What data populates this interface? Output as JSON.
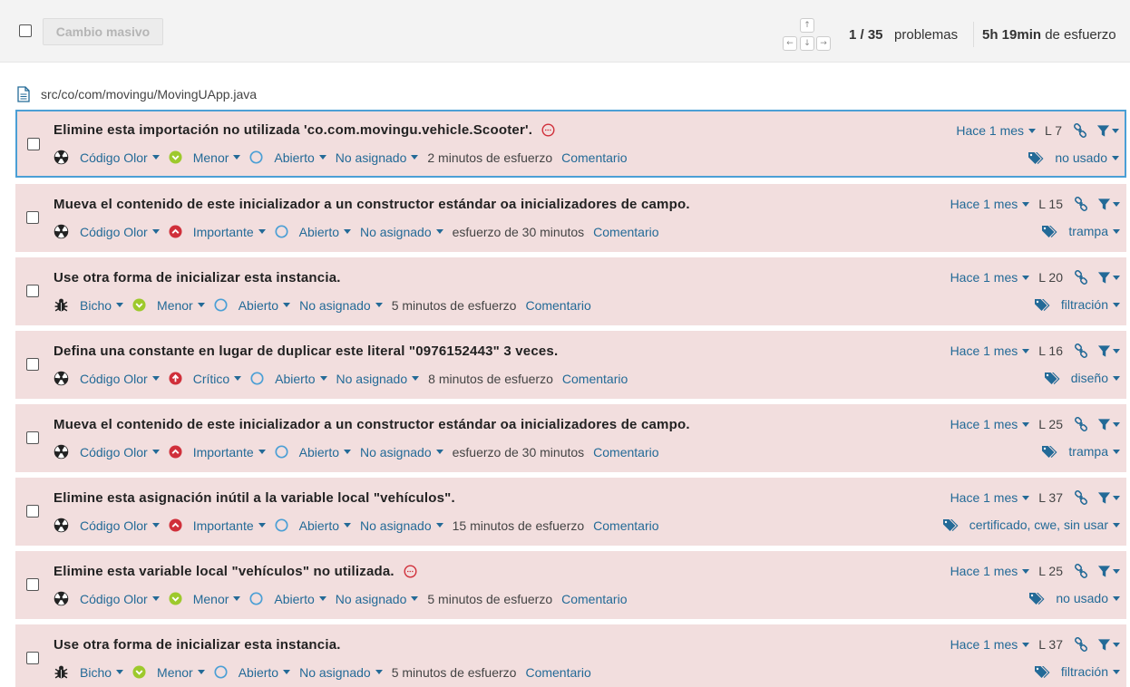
{
  "toolbar": {
    "bulk_change_label": "Cambio masivo",
    "keys": {
      "up": "↑",
      "left": "←",
      "down": "↓",
      "right": "→"
    },
    "counter_current": "1 / 35",
    "counter_label": "problemas",
    "effort_value": "5h 19min",
    "effort_label": "de esfuerzo"
  },
  "file": {
    "path": "src/co/com/movingu/MovingUApp.java"
  },
  "issues": [
    {
      "message": "Elimine esta importación no utilizada 'co.com.movingu.vehicle.Scooter'.",
      "type": "Código Olor",
      "severity": "Menor",
      "status": "Abierto",
      "assignee": "No asignado",
      "effort": "2 minutos de esfuerzo",
      "comment": "Comentario",
      "when": "Hace 1 mes",
      "line": "L 7",
      "tags": "no usado"
    },
    {
      "message": "Mueva el contenido de este inicializador a un constructor estándar oa inicializadores de campo.",
      "type": "Código Olor",
      "severity": "Importante",
      "status": "Abierto",
      "assignee": "No asignado",
      "effort": "esfuerzo de 30 minutos",
      "comment": "Comentario",
      "when": "Hace 1 mes",
      "line": "L 15",
      "tags": "trampa"
    },
    {
      "message": "Use otra forma de inicializar esta instancia.",
      "type": "Bicho",
      "severity": "Menor",
      "status": "Abierto",
      "assignee": "No asignado",
      "effort": "5 minutos de esfuerzo",
      "comment": "Comentario",
      "when": "Hace 1 mes",
      "line": "L 20",
      "tags": "filtración"
    },
    {
      "message": "Defina una constante en lugar de duplicar este literal \"0976152443\" 3 veces.",
      "type": "Código Olor",
      "severity": "Crítico",
      "status": "Abierto",
      "assignee": "No asignado",
      "effort": "8 minutos de esfuerzo",
      "comment": "Comentario",
      "when": "Hace 1 mes",
      "line": "L 16",
      "tags": "diseño"
    },
    {
      "message": "Mueva el contenido de este inicializador a un constructor estándar oa inicializadores de campo.",
      "type": "Código Olor",
      "severity": "Importante",
      "status": "Abierto",
      "assignee": "No asignado",
      "effort": "esfuerzo de 30 minutos",
      "comment": "Comentario",
      "when": "Hace 1 mes",
      "line": "L 25",
      "tags": "trampa"
    },
    {
      "message": "Elimine esta asignación inútil a la variable local \"vehículos\".",
      "type": "Código Olor",
      "severity": "Importante",
      "status": "Abierto",
      "assignee": "No asignado",
      "effort": "15 minutos de esfuerzo",
      "comment": "Comentario",
      "when": "Hace 1 mes",
      "line": "L 37",
      "tags": "certificado, cwe, sin usar"
    },
    {
      "message": "Elimine esta variable local \"vehículos\" no utilizada.",
      "type": "Código Olor",
      "severity": "Menor",
      "status": "Abierto",
      "assignee": "No asignado",
      "effort": "5 minutos de esfuerzo",
      "comment": "Comentario",
      "when": "Hace 1 mes",
      "line": "L 25",
      "tags": "no usado"
    },
    {
      "message": "Use otra forma de inicializar esta instancia.",
      "type": "Bicho",
      "severity": "Menor",
      "status": "Abierto",
      "assignee": "No asignado",
      "effort": "5 minutos de esfuerzo",
      "comment": "Comentario",
      "when": "Hace 1 mes",
      "line": "L 37",
      "tags": "filtración"
    }
  ],
  "colors": {
    "issue_background": "#f2dede",
    "link": "#236a97",
    "selected_border": "#4b9fd5",
    "severity_minor": "#9dc92c",
    "severity_major": "#d02f3a",
    "status_open": "#4b9fd5",
    "deprecated_badge": "#d02f3a"
  }
}
